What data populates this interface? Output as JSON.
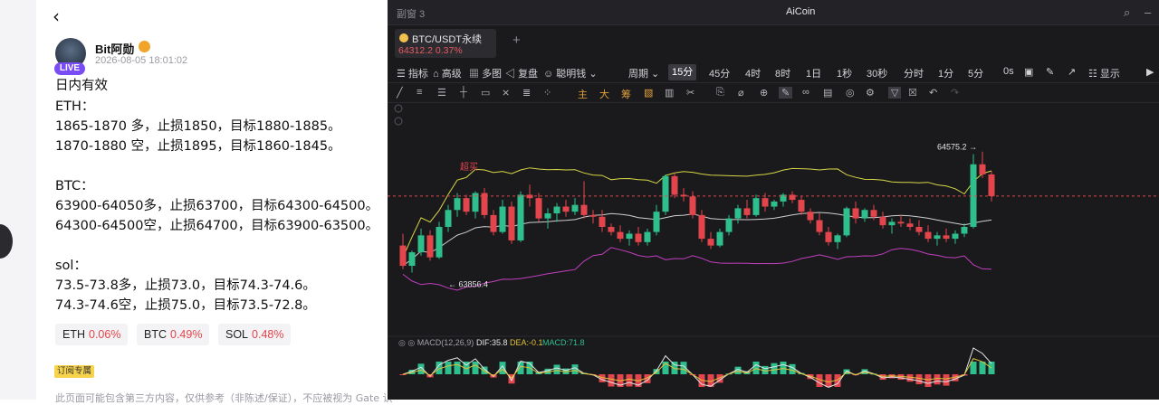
{
  "post": {
    "back_icon": "chevron-left-icon",
    "author": "Bit阿勋",
    "live": "LIVE",
    "date": "2026-08-05 18:01:02",
    "lines": [
      "日内有效",
      "ETH：",
      "1865-1870 多，止损1850，目标1880-1885。",
      "1870-1880 空，止损1895，目标1860-1845。",
      "",
      "BTC：",
      " 63900-64050多，止损63700，目标64300-64500。",
      "64300-64500空，止损64700，目标63900-63500。",
      "",
      "sol：",
      "73.5-73.8多，止损73.0，目标74.3-74.6。",
      "74.3-74.6空，止损75.0，目标73.5-72.8。"
    ],
    "chips": [
      {
        "symbol": "ETH",
        "pct": "0.06%"
      },
      {
        "symbol": "BTC",
        "pct": "0.49%"
      },
      {
        "symbol": "SOL",
        "pct": "0.48%"
      }
    ],
    "subscribe_tag": "订阅专属",
    "disclaimer": "此页面可能包含第三方内容，仅供参考（非陈述/保证），不应被视为 Gate 认"
  },
  "app": {
    "window_title": "副窗 3",
    "app_name": "AiCoin",
    "symbol": {
      "name": "BTC/USDT永续",
      "price": "64312.2",
      "change": "0.37%"
    },
    "add_tab": "+",
    "toolbar": {
      "indicator": "指标",
      "advanced": "高级",
      "multi": "多图",
      "replay": "复盘",
      "smart": "聪明钱",
      "period": "周期",
      "periods": [
        "15分",
        "45分",
        "4时",
        "8时",
        "1日",
        "1秒",
        "30秒",
        "分时",
        "1分",
        "5分",
        "0s"
      ],
      "active_period": "15分",
      "show": "显示"
    },
    "drawbar": [
      "主",
      "大",
      "筹"
    ],
    "colors": {
      "up": "#2fbf8c",
      "down": "#e2454c",
      "upper_band": "#d6d646",
      "mid_band": "#cfcfcf",
      "lower_band": "#c13fbe",
      "dashed": "#e2454c"
    }
  },
  "chart_data": {
    "type": "candlestick",
    "symbol": "BTC/USDT永续",
    "interval": "15分",
    "annotations": {
      "high_label": "64575.2",
      "low_label": "63856.4",
      "overbought": "超买"
    },
    "ohlc": [
      [
        64020,
        64090,
        63880,
        63900
      ],
      [
        63900,
        63990,
        63860,
        63980
      ],
      [
        63980,
        64120,
        63960,
        64080
      ],
      [
        64080,
        64110,
        63930,
        63950
      ],
      [
        63950,
        64160,
        63940,
        64130
      ],
      [
        64130,
        64260,
        64100,
        64230
      ],
      [
        64230,
        64330,
        64190,
        64300
      ],
      [
        64300,
        64320,
        64200,
        64220
      ],
      [
        64220,
        64340,
        64180,
        64330
      ],
      [
        64330,
        64360,
        64180,
        64200
      ],
      [
        64200,
        64230,
        64080,
        64100
      ],
      [
        64100,
        64290,
        64090,
        64250
      ],
      [
        64250,
        64280,
        64030,
        64050
      ],
      [
        64050,
        64340,
        64040,
        64320
      ],
      [
        64320,
        64380,
        64250,
        64300
      ],
      [
        64300,
        64330,
        64160,
        64180
      ],
      [
        64180,
        64240,
        64120,
        64210
      ],
      [
        64210,
        64270,
        64160,
        64250
      ],
      [
        64250,
        64290,
        64190,
        64220
      ],
      [
        64220,
        64300,
        64200,
        64260
      ],
      [
        64260,
        64400,
        64180,
        64200
      ],
      [
        64200,
        64230,
        64150,
        64190
      ],
      [
        64190,
        64230,
        64100,
        64130
      ],
      [
        64130,
        64150,
        64080,
        64100
      ],
      [
        64100,
        64140,
        64040,
        64060
      ],
      [
        64060,
        64110,
        64020,
        64090
      ],
      [
        64090,
        64130,
        64020,
        64040
      ],
      [
        64040,
        64120,
        64020,
        64100
      ],
      [
        64100,
        64260,
        64080,
        64220
      ],
      [
        64220,
        64440,
        64200,
        64430
      ],
      [
        64430,
        64450,
        64300,
        64320
      ],
      [
        64320,
        64360,
        64280,
        64310
      ],
      [
        64310,
        64340,
        64180,
        64200
      ],
      [
        64200,
        64230,
        64040,
        64060
      ],
      [
        64060,
        64100,
        64000,
        64020
      ],
      [
        64020,
        64120,
        64010,
        64100
      ],
      [
        64100,
        64200,
        64080,
        64180
      ],
      [
        64180,
        64260,
        64150,
        64240
      ],
      [
        64240,
        64290,
        64180,
        64200
      ],
      [
        64200,
        64320,
        64190,
        64300
      ],
      [
        64300,
        64330,
        64220,
        64250
      ],
      [
        64250,
        64290,
        64230,
        64280
      ],
      [
        64280,
        64330,
        64250,
        64320
      ],
      [
        64320,
        64340,
        64270,
        64290
      ],
      [
        64290,
        64310,
        64200,
        64220
      ],
      [
        64220,
        64240,
        64150,
        64170
      ],
      [
        64170,
        64210,
        64080,
        64100
      ],
      [
        64100,
        64130,
        64020,
        64040
      ],
      [
        64040,
        64090,
        64000,
        64080
      ],
      [
        64080,
        64250,
        64070,
        64240
      ],
      [
        64240,
        64280,
        64150,
        64180
      ],
      [
        64180,
        64240,
        64160,
        64230
      ],
      [
        64230,
        64260,
        64170,
        64190
      ],
      [
        64190,
        64220,
        64120,
        64140
      ],
      [
        64140,
        64180,
        64090,
        64160
      ],
      [
        64160,
        64200,
        64130,
        64150
      ],
      [
        64150,
        64180,
        64110,
        64130
      ],
      [
        64130,
        64170,
        64080,
        64100
      ],
      [
        64100,
        64140,
        64040,
        64060
      ],
      [
        64060,
        64100,
        64020,
        64080
      ],
      [
        64080,
        64120,
        64040,
        64060
      ],
      [
        64060,
        64110,
        64030,
        64090
      ],
      [
        64090,
        64150,
        64070,
        64130
      ],
      [
        64130,
        64560,
        64120,
        64500
      ],
      [
        64500,
        64575,
        64420,
        64440
      ],
      [
        64440,
        64460,
        64280,
        64312
      ]
    ],
    "macd": {
      "params": "MACD(12,26,9)",
      "dif": "35.8",
      "dea": "-0.1",
      "macd": "71.8"
    }
  }
}
